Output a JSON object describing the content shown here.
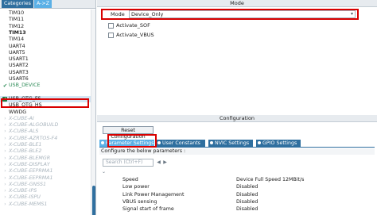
{
  "categories_tabs": {
    "categories": "Categories",
    "az": "A->Z"
  },
  "peripherals": [
    {
      "label": "TIM10",
      "mark": "none",
      "style": "normal"
    },
    {
      "label": "TIM11",
      "mark": "none",
      "style": "normal"
    },
    {
      "label": "TIM12",
      "mark": "none",
      "style": "normal"
    },
    {
      "label": "TIM13",
      "mark": "none",
      "style": "bold"
    },
    {
      "label": "TIM14",
      "mark": "none",
      "style": "normal"
    },
    {
      "label": "UART4",
      "mark": "none",
      "style": "normal"
    },
    {
      "label": "UART5",
      "mark": "none",
      "style": "normal"
    },
    {
      "label": "USART1",
      "mark": "none",
      "style": "normal"
    },
    {
      "label": "USART2",
      "mark": "none",
      "style": "normal"
    },
    {
      "label": "USART3",
      "mark": "none",
      "style": "normal"
    },
    {
      "label": "USART6",
      "mark": "none",
      "style": "normal"
    },
    {
      "label": "USB_DEVICE",
      "mark": "check",
      "style": "enabled"
    },
    {
      "label": "",
      "mark": "none",
      "style": "normal"
    },
    {
      "label": "USB_OTG_FS",
      "mark": "box-check",
      "style": "selected"
    },
    {
      "label": "USB_OTG_HS",
      "mark": "none",
      "style": "normal"
    },
    {
      "label": "WWDG",
      "mark": "none",
      "style": "normal"
    },
    {
      "label": "X-CUBE-AI",
      "mark": "chev",
      "style": "mw"
    },
    {
      "label": "X-CUBE-ALGOBUILD",
      "mark": "chev",
      "style": "mw"
    },
    {
      "label": "X-CUBE-ALS",
      "mark": "chev",
      "style": "mw"
    },
    {
      "label": "X-CUBE-AZRTOS-F4",
      "mark": "chev",
      "style": "mw"
    },
    {
      "label": "X-CUBE-BLE1",
      "mark": "chev",
      "style": "mw"
    },
    {
      "label": "X-CUBE-BLE2",
      "mark": "chev",
      "style": "mw"
    },
    {
      "label": "X-CUBE-BLEMGR",
      "mark": "chev",
      "style": "mw"
    },
    {
      "label": "X-CUBE-DISPLAY",
      "mark": "chev",
      "style": "mw"
    },
    {
      "label": "X-CUBE-EEPRMA1",
      "mark": "chev",
      "style": "mw"
    },
    {
      "label": "X-CUBE-EEPRMA1",
      "mark": "chev",
      "style": "mw"
    },
    {
      "label": "X-CUBE-GNSS1",
      "mark": "chev",
      "style": "mw"
    },
    {
      "label": "X-CUBE-IPS",
      "mark": "chev",
      "style": "mw"
    },
    {
      "label": "X-CUBE-ISPU",
      "mark": "chev",
      "style": "mw"
    },
    {
      "label": "X-CUBE-MEMS1",
      "mark": "chev",
      "style": "mw"
    }
  ],
  "mode": {
    "header": "Mode",
    "label": "Mode",
    "value": "Device_Only",
    "checkboxes": [
      {
        "label": "Activate_SOF",
        "checked": false
      },
      {
        "label": "Activate_VBUS",
        "checked": false
      }
    ]
  },
  "configuration": {
    "header": "Configuration",
    "reset_button": "Reset Configuration",
    "tabs": [
      {
        "label": "Parameter Settings",
        "active": true
      },
      {
        "label": "User Constants",
        "active": false
      },
      {
        "label": "NVIC Settings",
        "active": false
      },
      {
        "label": "GPIO Settings",
        "active": false
      }
    ],
    "caption": "Configure the below parameters :",
    "search_placeholder": "Search (Ctrl+F)",
    "parameters": [
      {
        "name": "Speed",
        "value": "Device Full Speed 12MBit/s"
      },
      {
        "name": "Low power",
        "value": "Disabled"
      },
      {
        "name": "Link Power Management",
        "value": "Disabled"
      },
      {
        "name": "VBUS sensing",
        "value": "Disabled"
      },
      {
        "name": "Signal start of frame",
        "value": "Disabled"
      }
    ]
  },
  "colors": {
    "accent": "#2f6f9f",
    "active_tab": "#5bb0e6",
    "highlight": "#d80000",
    "enabled": "#2e8b57"
  },
  "icons": {
    "check": "check-icon",
    "box_check": "checked-box-icon",
    "chevron": "chevron-right-icon",
    "search_prev": "arrow-left-icon",
    "search_next": "arrow-right-icon",
    "expand": "chevron-down-icon",
    "dropdown": "chevron-down-icon"
  }
}
